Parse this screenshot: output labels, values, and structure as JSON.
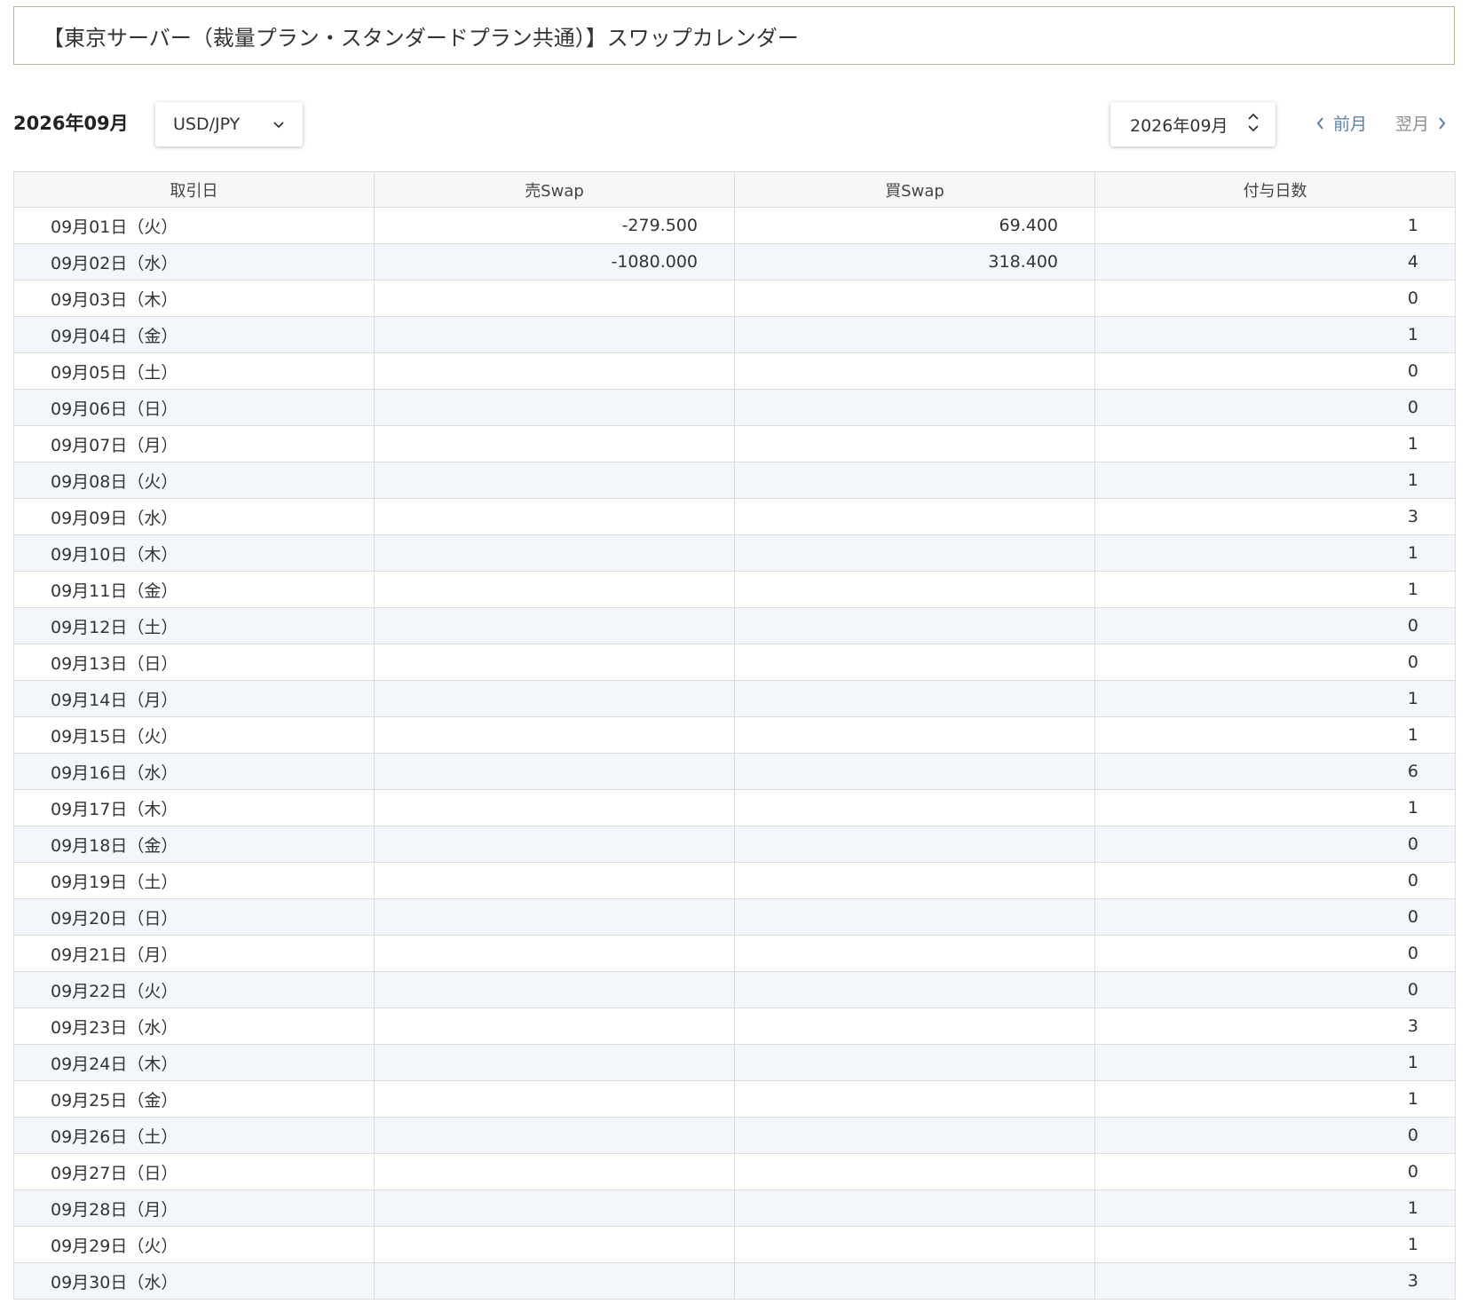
{
  "header": {
    "title": "【東京サーバー（裁量プラン・スタンダードプラン共通）】スワップカレンダー"
  },
  "toolbar": {
    "current_month": "2026年09月",
    "pair_select_value": "USD/JPY",
    "month_select_value": "2026年09月",
    "prev_label": "前月",
    "next_label": "翌月"
  },
  "table": {
    "columns": [
      "取引日",
      "売Swap",
      "買Swap",
      "付与日数"
    ],
    "rows": [
      {
        "date": "09月01日（火）",
        "sell": "-279.500",
        "buy": "69.400",
        "days": "1"
      },
      {
        "date": "09月02日（水）",
        "sell": "-1080.000",
        "buy": "318.400",
        "days": "4"
      },
      {
        "date": "09月03日（木）",
        "sell": "",
        "buy": "",
        "days": "0"
      },
      {
        "date": "09月04日（金）",
        "sell": "",
        "buy": "",
        "days": "1"
      },
      {
        "date": "09月05日（土）",
        "sell": "",
        "buy": "",
        "days": "0"
      },
      {
        "date": "09月06日（日）",
        "sell": "",
        "buy": "",
        "days": "0"
      },
      {
        "date": "09月07日（月）",
        "sell": "",
        "buy": "",
        "days": "1"
      },
      {
        "date": "09月08日（火）",
        "sell": "",
        "buy": "",
        "days": "1"
      },
      {
        "date": "09月09日（水）",
        "sell": "",
        "buy": "",
        "days": "3"
      },
      {
        "date": "09月10日（木）",
        "sell": "",
        "buy": "",
        "days": "1"
      },
      {
        "date": "09月11日（金）",
        "sell": "",
        "buy": "",
        "days": "1"
      },
      {
        "date": "09月12日（土）",
        "sell": "",
        "buy": "",
        "days": "0"
      },
      {
        "date": "09月13日（日）",
        "sell": "",
        "buy": "",
        "days": "0"
      },
      {
        "date": "09月14日（月）",
        "sell": "",
        "buy": "",
        "days": "1"
      },
      {
        "date": "09月15日（火）",
        "sell": "",
        "buy": "",
        "days": "1"
      },
      {
        "date": "09月16日（水）",
        "sell": "",
        "buy": "",
        "days": "6"
      },
      {
        "date": "09月17日（木）",
        "sell": "",
        "buy": "",
        "days": "1"
      },
      {
        "date": "09月18日（金）",
        "sell": "",
        "buy": "",
        "days": "0"
      },
      {
        "date": "09月19日（土）",
        "sell": "",
        "buy": "",
        "days": "0"
      },
      {
        "date": "09月20日（日）",
        "sell": "",
        "buy": "",
        "days": "0"
      },
      {
        "date": "09月21日（月）",
        "sell": "",
        "buy": "",
        "days": "0"
      },
      {
        "date": "09月22日（火）",
        "sell": "",
        "buy": "",
        "days": "0"
      },
      {
        "date": "09月23日（水）",
        "sell": "",
        "buy": "",
        "days": "3"
      },
      {
        "date": "09月24日（木）",
        "sell": "",
        "buy": "",
        "days": "1"
      },
      {
        "date": "09月25日（金）",
        "sell": "",
        "buy": "",
        "days": "1"
      },
      {
        "date": "09月26日（土）",
        "sell": "",
        "buy": "",
        "days": "0"
      },
      {
        "date": "09月27日（日）",
        "sell": "",
        "buy": "",
        "days": "0"
      },
      {
        "date": "09月28日（月）",
        "sell": "",
        "buy": "",
        "days": "1"
      },
      {
        "date": "09月29日（火）",
        "sell": "",
        "buy": "",
        "days": "1"
      },
      {
        "date": "09月30日（水）",
        "sell": "",
        "buy": "",
        "days": "3"
      }
    ]
  },
  "icons": {
    "pair_select": "chevron-down-icon",
    "month_select": "up-down-chevron-icon",
    "prev": "chevron-left-icon",
    "next": "chevron-right-icon"
  },
  "colors": {
    "title_border": "#b7b79a",
    "nav_link": "#5b7fa6",
    "nav_disabled": "#8d8d8d",
    "row_stripe": "#f3f7fc",
    "grid_line": "#dcdcdc"
  }
}
